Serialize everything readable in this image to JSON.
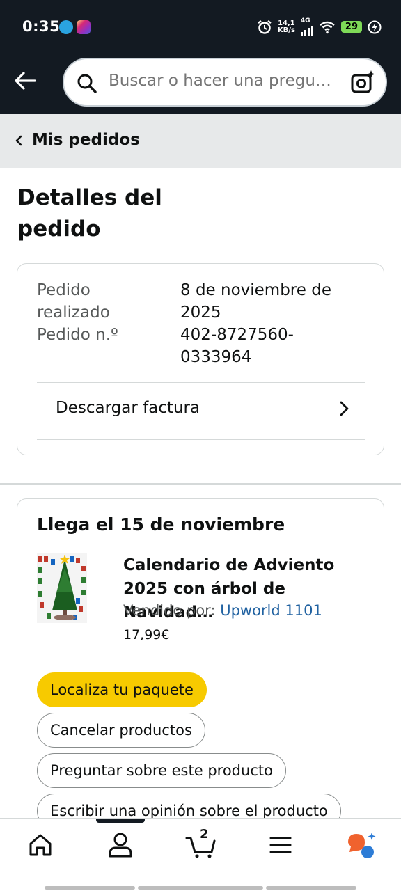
{
  "status_bar": {
    "time": "0:35",
    "net_speed_value": "14,1",
    "net_speed_unit": "KB/s",
    "network_type": "4G",
    "battery": "29"
  },
  "search": {
    "placeholder": "Buscar o hacer una pregu…"
  },
  "breadcrumb": {
    "label": "Mis pedidos"
  },
  "page_title": "Detalles del pedido",
  "order": {
    "placed_label": "Pedido realizado",
    "placed_value": "8 de noviembre de 2025",
    "number_label": "Pedido n.º",
    "number_value": "402-8727560-0333964",
    "invoice_label": "Descargar factura"
  },
  "shipment": {
    "title": "Llega el 15 de noviembre",
    "product_title": "Calendario de Adviento 2025 con árbol de Navidad…",
    "sold_by_label": "Vendido por:",
    "seller": "Upworld 1101",
    "price": "17,99€",
    "buttons": {
      "track": "Localiza tu paquete",
      "cancel": "Cancelar productos",
      "ask": "Preguntar sobre este producto",
      "review": "Escribir una opinión sobre el producto"
    }
  },
  "bottom_nav": {
    "cart_count": "2",
    "icons": [
      "home-icon",
      "account-icon",
      "cart-icon",
      "menu-icon",
      "rufus-assistant-icon"
    ]
  },
  "colors": {
    "header_bg": "#131a22",
    "primary_button": "#f7ca00",
    "link": "#2162a1"
  }
}
